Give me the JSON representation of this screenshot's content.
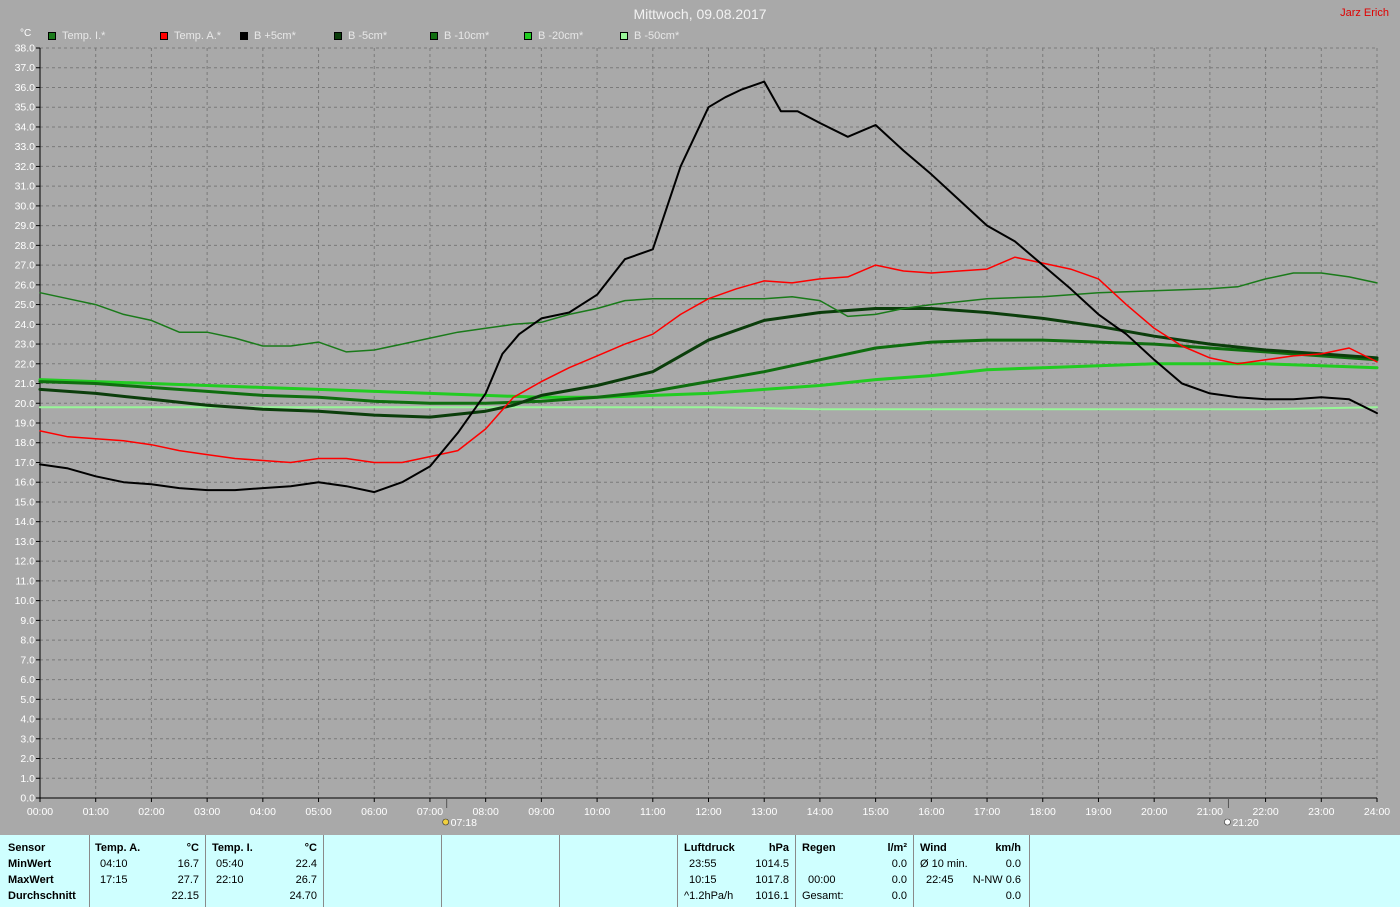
{
  "title": "Mittwoch, 09.08.2017",
  "author": "Jarz Erich",
  "y_unit": "°C",
  "legend": [
    {
      "label": "Temp. I.*",
      "color": "#1a7a1a"
    },
    {
      "label": "Temp. A.*",
      "color": "#ff0000"
    },
    {
      "label": "B +5cm*",
      "color": "#000000"
    },
    {
      "label": "B -5cm*",
      "color": "#0b3d0b"
    },
    {
      "label": "B -10cm*",
      "color": "#0f6e0f"
    },
    {
      "label": "B -20cm*",
      "color": "#22cc22"
    },
    {
      "label": "B -50cm*",
      "color": "#98f598"
    }
  ],
  "sun": {
    "sunrise": "07:18",
    "sunset": "21:20"
  },
  "chart_data": {
    "type": "line",
    "title": "Mittwoch, 09.08.2017",
    "ylabel": "°C",
    "xlabel": "",
    "ylim": [
      0,
      38
    ],
    "xlim": [
      0,
      24
    ],
    "grid": true,
    "legend_position": "top-left",
    "x_ticks": [
      "00:00",
      "01:00",
      "02:00",
      "03:00",
      "04:00",
      "05:00",
      "06:00",
      "07:00",
      "08:00",
      "09:00",
      "10:00",
      "11:00",
      "12:00",
      "13:00",
      "14:00",
      "15:00",
      "16:00",
      "17:00",
      "18:00",
      "19:00",
      "20:00",
      "21:00",
      "22:00",
      "23:00",
      "24:00"
    ],
    "y_ticks": [
      "0.0",
      "1.0",
      "2.0",
      "3.0",
      "4.0",
      "5.0",
      "6.0",
      "7.0",
      "8.0",
      "9.0",
      "10.0",
      "11.0",
      "12.0",
      "13.0",
      "14.0",
      "15.0",
      "16.0",
      "17.0",
      "18.0",
      "19.0",
      "20.0",
      "21.0",
      "22.0",
      "23.0",
      "24.0",
      "25.0",
      "26.0",
      "27.0",
      "28.0",
      "29.0",
      "30.0",
      "31.0",
      "32.0",
      "33.0",
      "34.0",
      "35.0",
      "36.0",
      "37.0",
      "38.0"
    ],
    "series": [
      {
        "name": "Temp. I.*",
        "color": "#1a7a1a",
        "width": 1.5,
        "x": [
          0,
          0.5,
          1,
          1.5,
          2,
          2.5,
          3,
          3.5,
          4,
          4.5,
          5,
          5.5,
          6,
          6.5,
          7,
          7.5,
          8,
          8.5,
          9,
          9.5,
          10,
          10.5,
          11,
          11.5,
          12,
          12.5,
          13,
          13.5,
          14,
          14.5,
          15,
          15.5,
          16,
          17,
          18,
          19,
          20,
          21,
          21.5,
          22,
          22.5,
          23,
          23.5,
          24
        ],
        "y": [
          25.6,
          25.3,
          25.0,
          24.5,
          24.2,
          23.6,
          23.6,
          23.3,
          22.9,
          22.9,
          23.1,
          22.6,
          22.7,
          23.0,
          23.3,
          23.6,
          23.8,
          24.0,
          24.1,
          24.5,
          24.8,
          25.2,
          25.3,
          25.3,
          25.3,
          25.3,
          25.3,
          25.4,
          25.2,
          24.4,
          24.5,
          24.8,
          25.0,
          25.3,
          25.4,
          25.6,
          25.7,
          25.8,
          25.9,
          26.3,
          26.6,
          26.6,
          26.4,
          26.1
        ]
      },
      {
        "name": "Temp. A.*",
        "color": "#ff0000",
        "width": 1.5,
        "x": [
          0,
          0.5,
          1,
          1.5,
          2,
          2.5,
          3,
          3.5,
          4,
          4.5,
          5,
          5.5,
          6,
          6.5,
          7,
          7.5,
          8,
          8.5,
          9,
          9.5,
          10,
          10.5,
          11,
          11.5,
          12,
          12.5,
          13,
          13.5,
          14,
          14.5,
          15,
          15.5,
          16,
          16.5,
          17,
          17.5,
          18,
          18.5,
          19,
          19.5,
          20,
          20.5,
          21,
          21.5,
          22,
          22.5,
          23,
          23.5,
          24
        ],
        "y": [
          18.6,
          18.3,
          18.2,
          18.1,
          17.9,
          17.6,
          17.4,
          17.2,
          17.1,
          17.0,
          17.2,
          17.2,
          17.0,
          17.0,
          17.3,
          17.6,
          18.7,
          20.3,
          21.1,
          21.8,
          22.4,
          23.0,
          23.5,
          24.5,
          25.3,
          25.8,
          26.2,
          26.1,
          26.3,
          26.4,
          27.0,
          26.7,
          26.6,
          26.7,
          26.8,
          27.4,
          27.1,
          26.8,
          26.3,
          25.0,
          23.8,
          22.9,
          22.3,
          22.0,
          22.2,
          22.4,
          22.5,
          22.8,
          22.1
        ]
      },
      {
        "name": "B +5cm*",
        "color": "#000000",
        "width": 2,
        "x": [
          0,
          0.5,
          1,
          1.5,
          2,
          2.5,
          3,
          3.5,
          4,
          4.5,
          5,
          5.5,
          6,
          6.5,
          7,
          7.5,
          8,
          8.3,
          8.6,
          9,
          9.5,
          10,
          10.5,
          11,
          11.5,
          12,
          12.3,
          12.6,
          13,
          13.3,
          13.6,
          14,
          14.5,
          15,
          15.5,
          16,
          16.5,
          17,
          17.5,
          18,
          18.5,
          19,
          19.5,
          20,
          20.5,
          21,
          21.5,
          22,
          22.5,
          23,
          23.5,
          24
        ],
        "y": [
          16.9,
          16.7,
          16.3,
          16.0,
          15.9,
          15.7,
          15.6,
          15.6,
          15.7,
          15.8,
          16.0,
          15.8,
          15.5,
          16.0,
          16.8,
          18.5,
          20.5,
          22.5,
          23.5,
          24.3,
          24.6,
          25.5,
          27.3,
          27.8,
          32.0,
          35.0,
          35.5,
          35.9,
          36.3,
          34.8,
          34.8,
          34.2,
          33.5,
          34.1,
          32.8,
          31.6,
          30.3,
          29.0,
          28.2,
          27.0,
          25.8,
          24.5,
          23.5,
          22.2,
          21.0,
          20.5,
          20.3,
          20.2,
          20.2,
          20.3,
          20.2,
          19.5
        ]
      },
      {
        "name": "B -5cm*",
        "color": "#0b3d0b",
        "width": 3,
        "x": [
          0,
          1,
          2,
          3,
          4,
          5,
          6,
          7,
          8,
          8.5,
          9,
          10,
          11,
          12,
          13,
          14,
          15,
          16,
          17,
          18,
          19,
          20,
          21,
          22,
          23,
          24
        ],
        "y": [
          20.7,
          20.5,
          20.2,
          19.9,
          19.7,
          19.6,
          19.4,
          19.3,
          19.6,
          19.9,
          20.4,
          20.9,
          21.6,
          23.2,
          24.2,
          24.6,
          24.8,
          24.8,
          24.6,
          24.3,
          23.9,
          23.4,
          23.0,
          22.7,
          22.5,
          22.3
        ]
      },
      {
        "name": "B -10cm*",
        "color": "#0f6e0f",
        "width": 3,
        "x": [
          0,
          1,
          2,
          3,
          4,
          5,
          6,
          7,
          8,
          9,
          10,
          11,
          12,
          13,
          14,
          15,
          16,
          17,
          18,
          19,
          20,
          21,
          22,
          23,
          24
        ],
        "y": [
          21.1,
          21.0,
          20.8,
          20.6,
          20.4,
          20.3,
          20.1,
          20.0,
          20.0,
          20.1,
          20.3,
          20.6,
          21.1,
          21.6,
          22.2,
          22.8,
          23.1,
          23.2,
          23.2,
          23.1,
          23.0,
          22.8,
          22.6,
          22.4,
          22.2
        ]
      },
      {
        "name": "B -20cm*",
        "color": "#22cc22",
        "width": 3,
        "x": [
          0,
          1,
          2,
          3,
          4,
          5,
          6,
          7,
          8,
          9,
          10,
          11,
          12,
          13,
          14,
          15,
          16,
          17,
          18,
          19,
          20,
          21,
          22,
          23,
          24
        ],
        "y": [
          21.2,
          21.1,
          21.0,
          20.9,
          20.8,
          20.7,
          20.6,
          20.5,
          20.4,
          20.3,
          20.3,
          20.4,
          20.5,
          20.7,
          20.9,
          21.2,
          21.4,
          21.7,
          21.8,
          21.9,
          22.0,
          22.0,
          22.0,
          21.9,
          21.8
        ]
      },
      {
        "name": "B -50cm*",
        "color": "#98f598",
        "width": 2,
        "x": [
          0,
          2,
          4,
          6,
          8,
          10,
          12,
          14,
          16,
          18,
          20,
          22,
          24
        ],
        "y": [
          19.8,
          19.8,
          19.8,
          19.8,
          19.8,
          19.8,
          19.8,
          19.7,
          19.7,
          19.7,
          19.7,
          19.7,
          19.8
        ]
      }
    ]
  },
  "stats": {
    "row_labels": {
      "sensor": "Sensor",
      "min": "MinWert",
      "max": "MaxWert",
      "avg": "Durchschnitt"
    },
    "temp_a": {
      "header": "Temp. A.",
      "unit": "°C",
      "min_time": "04:10",
      "min_val": "16.7",
      "max_time": "17:15",
      "max_val": "27.7",
      "avg": "22.15"
    },
    "temp_i": {
      "header": "Temp. I.",
      "unit": "°C",
      "min_time": "05:40",
      "min_val": "22.4",
      "max_time": "22:10",
      "max_val": "26.7",
      "avg": "24.70"
    },
    "pressure": {
      "header": "Luftdruck",
      "unit": "hPa",
      "min_time": "23:55",
      "min_val": "1014.5",
      "max_time": "10:15",
      "max_val": "1017.8",
      "trend": "^1.2hPa/h",
      "avg": "1016.1"
    },
    "rain": {
      "header": "Regen",
      "unit": "l/m²",
      "max_time": "00:00",
      "max_val": "0.0",
      "total_label": "Gesamt:",
      "total": "0.0",
      "min_val": "0.0"
    },
    "wind": {
      "header": "Wind",
      "unit": "km/h",
      "avg_label": "Ø 10 min.",
      "avg_val": "0.0",
      "max_time": "22:45",
      "max_val": "N-NW 0.6",
      "total": "0.0"
    }
  }
}
